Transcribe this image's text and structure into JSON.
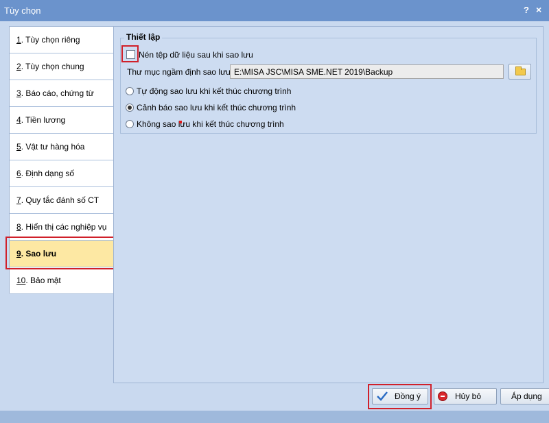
{
  "window": {
    "title": "Tùy chọn",
    "help_glyph": "?",
    "close_glyph": "×"
  },
  "sidebar": {
    "items": [
      {
        "num": "1",
        "sep": ".",
        "label": " Tùy chọn riêng"
      },
      {
        "num": "2",
        "sep": ".",
        "label": " Tùy chọn chung"
      },
      {
        "num": "3",
        "sep": ".",
        "label": " Báo cáo, chứng từ"
      },
      {
        "num": "4",
        "sep": ".",
        "label": " Tiền lương"
      },
      {
        "num": "5",
        "sep": ".",
        "label": " Vật tư hàng hóa"
      },
      {
        "num": "6",
        "sep": ".",
        "label": " Định dạng số"
      },
      {
        "num": "7",
        "sep": ".",
        "label": " Quy tắc đánh số CT"
      },
      {
        "num": "8",
        "sep": ".",
        "label": " Hiển thị các nghiệp vụ"
      },
      {
        "num": "9",
        "sep": ".",
        "label": " Sao lưu"
      },
      {
        "num": "10",
        "sep": ".",
        "label": " Bảo mật"
      }
    ],
    "selected_index": 8
  },
  "settings": {
    "group_title": "Thiết lập",
    "compress_label": "Nén tệp dữ liệu sau khi sao lưu",
    "compress_checked": false,
    "folder_label": "Thư mục ngầm định sao lưu",
    "folder_value": "E:\\MISA JSC\\MISA SME.NET 2019\\Backup",
    "folder_icon": "folder-icon",
    "options": [
      {
        "label": "Tự động sao lưu khi kết thúc chương trình",
        "checked": false
      },
      {
        "label": "Cảnh báo sao lưu khi kết thúc chương trình",
        "checked": true
      },
      {
        "label": "Không sao lưu khi kết thúc chương trình",
        "checked": false
      }
    ]
  },
  "footer": {
    "ok_label": "Đồng ý",
    "cancel_label": "Hủy bỏ",
    "apply_label": "Áp dụng"
  },
  "colors": {
    "titlebar": "#6b93cc",
    "highlight": "#d0202a",
    "selected_item": "#fde8a3"
  }
}
